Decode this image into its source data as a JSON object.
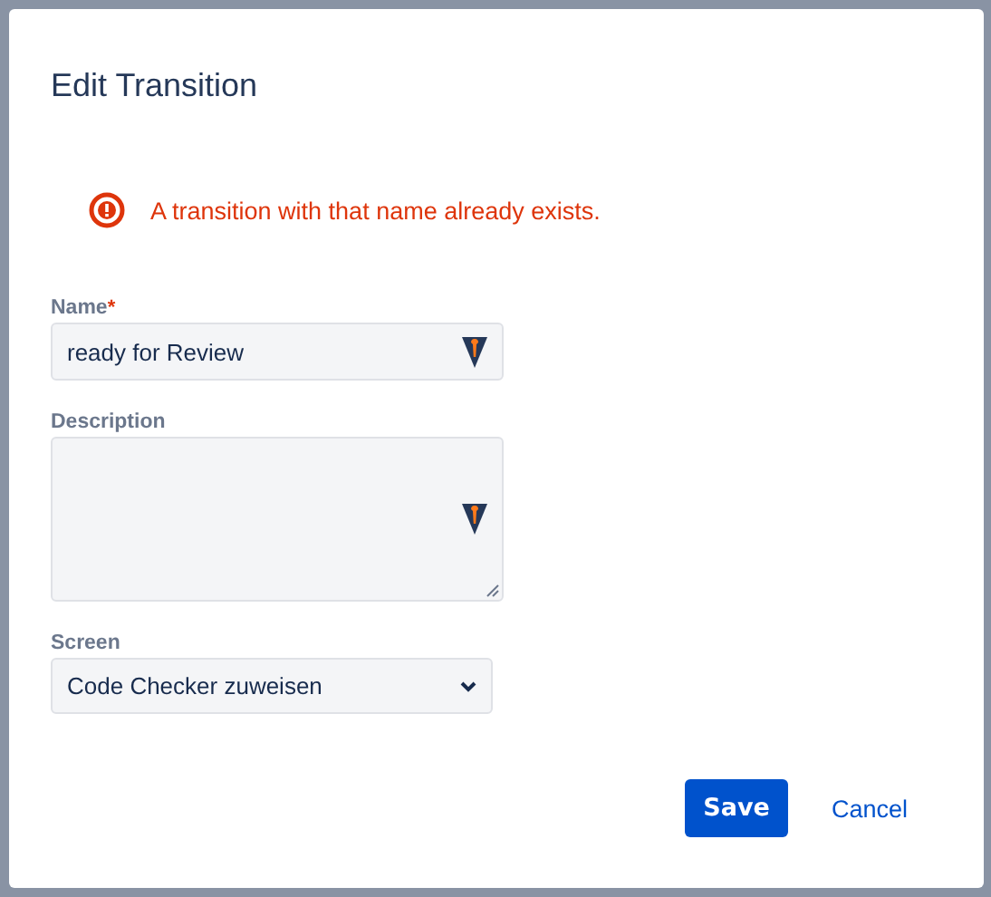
{
  "dialog": {
    "title": "Edit Transition"
  },
  "error": {
    "message": "A transition with that name already exists."
  },
  "fields": [
    {
      "kind": "text",
      "label": "Name",
      "required_mark": "*",
      "value": "ready for Review"
    },
    {
      "kind": "textarea",
      "label": "Description"
    },
    {
      "kind": "select",
      "label": "Screen",
      "value": "Code Checker zuweisen"
    }
  ],
  "buttons": [
    {
      "kind": "primary",
      "label": "Save"
    },
    {
      "kind": "link",
      "label": "Cancel"
    }
  ]
}
